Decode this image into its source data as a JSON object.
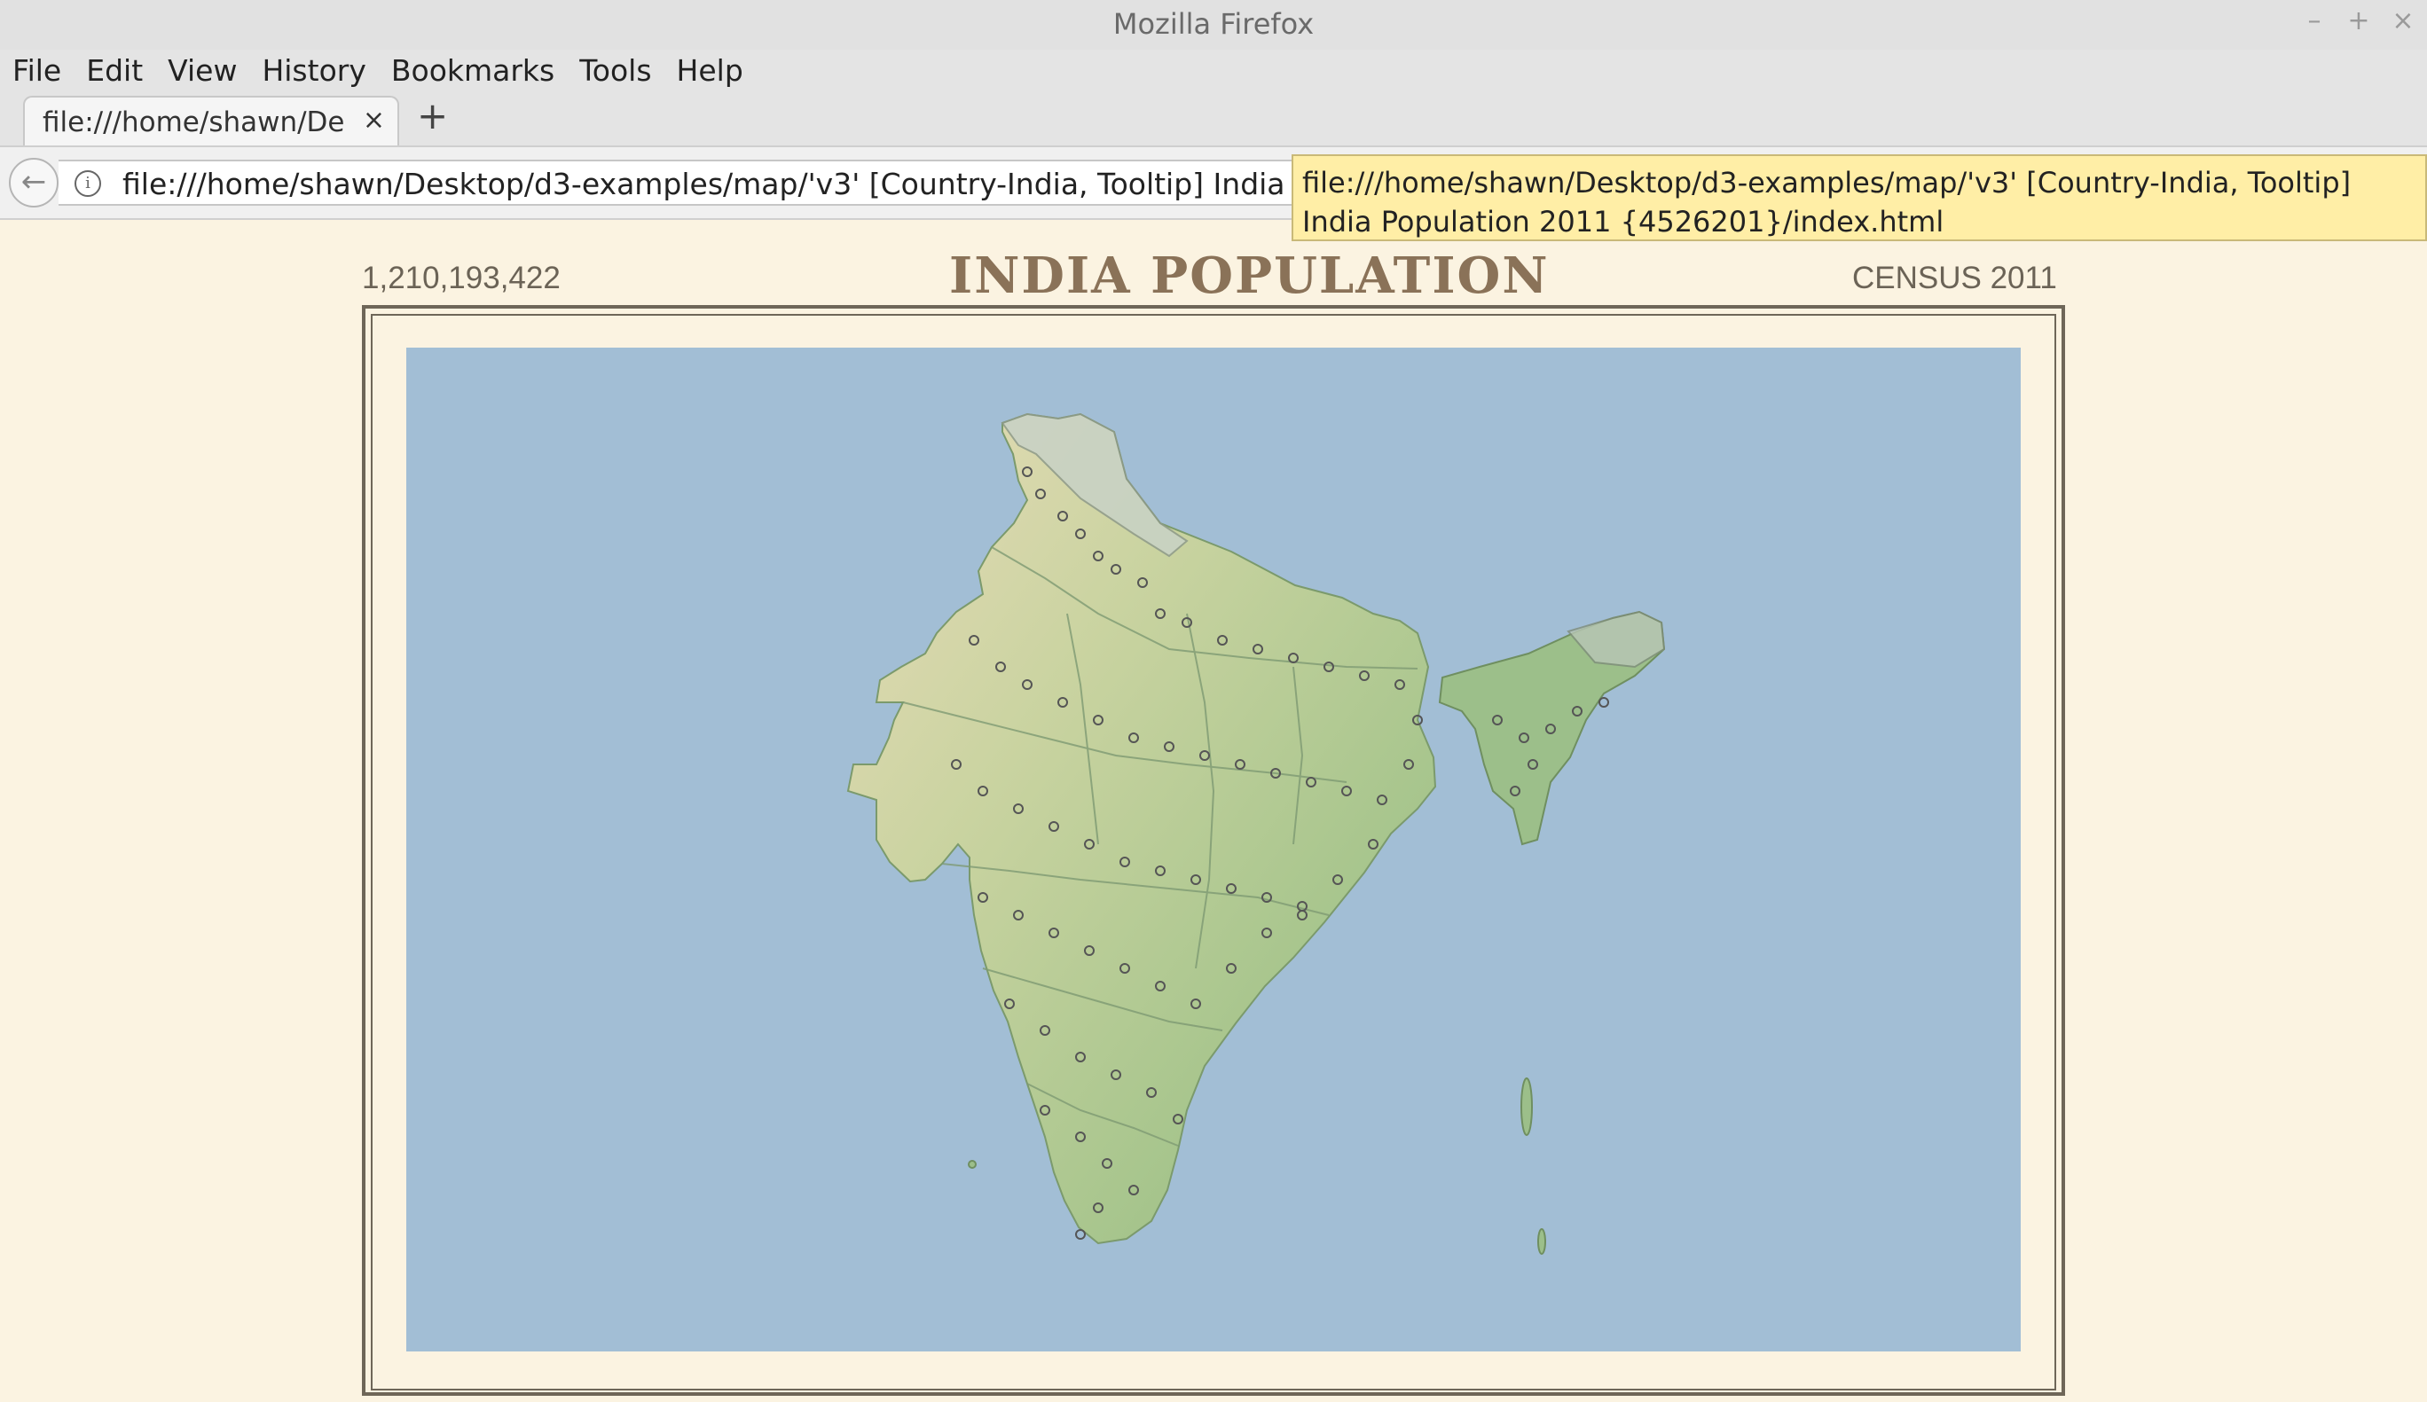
{
  "window": {
    "title": "Mozilla Firefox",
    "controls": [
      "–",
      "+",
      "×"
    ]
  },
  "menu": [
    "File",
    "Edit",
    "View",
    "History",
    "Bookmarks",
    "Tools",
    "Help"
  ],
  "tab": {
    "title": "file:///home/shawn/Desktop/d3-examples/map/'v3' [Country-India, Tooltip] India Population 2011 {4526201}/index.html",
    "close": "×",
    "new_tab": "+"
  },
  "navbar": {
    "back": "←",
    "info": "i",
    "url": "file:///home/shawn/Desktop/d3-examples/map/'v3' [Country-India, Tooltip] India Popula"
  },
  "tooltip": "file:///home/shawn/Desktop/d3-examples/map/'v3' [Country-India, Tooltip] India Population 2011 {4526201}/index.html",
  "page": {
    "total_population": "1,210,193,422",
    "title": "INDIA POPULATION",
    "census": "CENSUS 2011"
  },
  "colors": {
    "background": "#fbf3e1",
    "sea": "#a2bed5",
    "land": "#aec990",
    "frame": "#6e6658",
    "title": "#8a7258"
  }
}
